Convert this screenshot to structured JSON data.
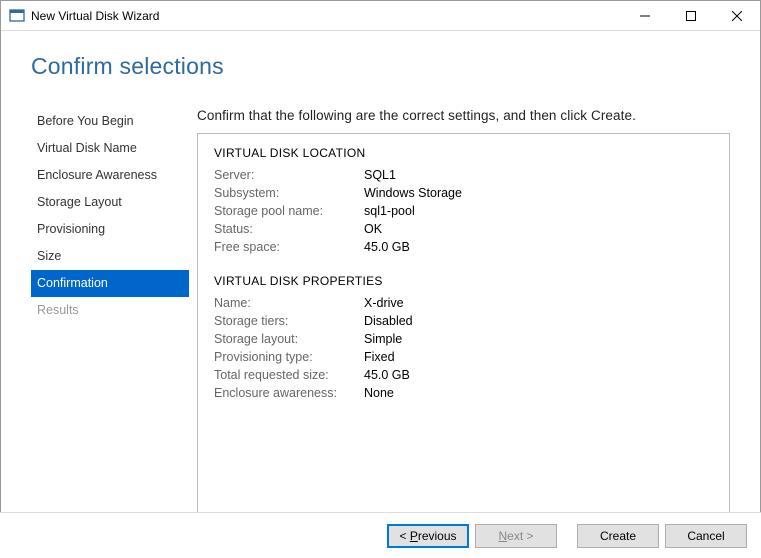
{
  "window": {
    "title": "New Virtual Disk Wizard"
  },
  "heading": "Confirm selections",
  "sidebar": {
    "items": [
      {
        "label": "Before You Begin",
        "state": "normal"
      },
      {
        "label": "Virtual Disk Name",
        "state": "normal"
      },
      {
        "label": "Enclosure Awareness",
        "state": "normal"
      },
      {
        "label": "Storage Layout",
        "state": "normal"
      },
      {
        "label": "Provisioning",
        "state": "normal"
      },
      {
        "label": "Size",
        "state": "normal"
      },
      {
        "label": "Confirmation",
        "state": "selected"
      },
      {
        "label": "Results",
        "state": "disabled"
      }
    ]
  },
  "instruction": "Confirm that the following are the correct settings, and then click Create.",
  "sections": {
    "location": {
      "title": "VIRTUAL DISK LOCATION",
      "rows": [
        {
          "k": "Server:",
          "v": "SQL1"
        },
        {
          "k": "Subsystem:",
          "v": "Windows Storage"
        },
        {
          "k": "Storage pool name:",
          "v": "sql1-pool"
        },
        {
          "k": "Status:",
          "v": "OK"
        },
        {
          "k": "Free space:",
          "v": "45.0 GB"
        }
      ]
    },
    "properties": {
      "title": "VIRTUAL DISK PROPERTIES",
      "rows": [
        {
          "k": "Name:",
          "v": "X-drive"
        },
        {
          "k": "Storage tiers:",
          "v": "Disabled"
        },
        {
          "k": "Storage layout:",
          "v": "Simple"
        },
        {
          "k": "Provisioning type:",
          "v": "Fixed"
        },
        {
          "k": "Total requested size:",
          "v": "45.0 GB"
        },
        {
          "k": "Enclosure awareness:",
          "v": "None"
        }
      ]
    }
  },
  "buttons": {
    "previous": "< Previous",
    "next": "Next >",
    "create": "Create",
    "cancel": "Cancel"
  }
}
